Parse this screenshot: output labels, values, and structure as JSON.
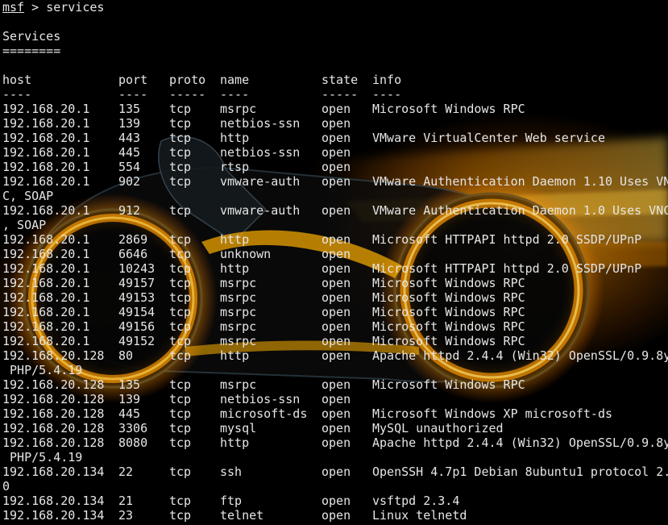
{
  "terminal": {
    "prompt": {
      "name": "msf",
      "separator": " > ",
      "command": "services"
    },
    "title": "Services",
    "title_underline": "========",
    "columns": [
      "host",
      "port",
      "proto",
      "name",
      "state",
      "info"
    ],
    "column_dashes": [
      "----",
      "----",
      "-----",
      "----",
      "-----",
      "----"
    ],
    "rows": [
      {
        "host": "192.168.20.1",
        "port": "135",
        "proto": "tcp",
        "name": "msrpc",
        "state": "open",
        "info": "Microsoft Windows RPC"
      },
      {
        "host": "192.168.20.1",
        "port": "139",
        "proto": "tcp",
        "name": "netbios-ssn",
        "state": "open",
        "info": ""
      },
      {
        "host": "192.168.20.1",
        "port": "443",
        "proto": "tcp",
        "name": "http",
        "state": "open",
        "info": "VMware VirtualCenter Web service"
      },
      {
        "host": "192.168.20.1",
        "port": "445",
        "proto": "tcp",
        "name": "netbios-ssn",
        "state": "open",
        "info": ""
      },
      {
        "host": "192.168.20.1",
        "port": "554",
        "proto": "tcp",
        "name": "rtsp",
        "state": "open",
        "info": ""
      },
      {
        "host": "192.168.20.1",
        "port": "902",
        "proto": "tcp",
        "name": "vmware-auth",
        "state": "open",
        "info": "VMware Authentication Daemon 1.10 Uses VN",
        "wrap": "C, SOAP"
      },
      {
        "host": "192.168.20.1",
        "port": "912",
        "proto": "tcp",
        "name": "vmware-auth",
        "state": "open",
        "info": "VMware Authentication Daemon 1.0 Uses VNC",
        "wrap": ", SOAP"
      },
      {
        "host": "192.168.20.1",
        "port": "2869",
        "proto": "tcp",
        "name": "http",
        "state": "open",
        "info": "Microsoft HTTPAPI httpd 2.0 SSDP/UPnP"
      },
      {
        "host": "192.168.20.1",
        "port": "6646",
        "proto": "tcp",
        "name": "unknown",
        "state": "open",
        "info": ""
      },
      {
        "host": "192.168.20.1",
        "port": "10243",
        "proto": "tcp",
        "name": "http",
        "state": "open",
        "info": "Microsoft HTTPAPI httpd 2.0 SSDP/UPnP"
      },
      {
        "host": "192.168.20.1",
        "port": "49157",
        "proto": "tcp",
        "name": "msrpc",
        "state": "open",
        "info": "Microsoft Windows RPC"
      },
      {
        "host": "192.168.20.1",
        "port": "49153",
        "proto": "tcp",
        "name": "msrpc",
        "state": "open",
        "info": "Microsoft Windows RPC"
      },
      {
        "host": "192.168.20.1",
        "port": "49154",
        "proto": "tcp",
        "name": "msrpc",
        "state": "open",
        "info": "Microsoft Windows RPC"
      },
      {
        "host": "192.168.20.1",
        "port": "49156",
        "proto": "tcp",
        "name": "msrpc",
        "state": "open",
        "info": "Microsoft Windows RPC"
      },
      {
        "host": "192.168.20.1",
        "port": "49152",
        "proto": "tcp",
        "name": "msrpc",
        "state": "open",
        "info": "Microsoft Windows RPC"
      },
      {
        "host": "192.168.20.128",
        "port": "80",
        "proto": "tcp",
        "name": "http",
        "state": "open",
        "info": "Apache httpd 2.4.4 (Win32) OpenSSL/0.9.8y",
        "wrap": " PHP/5.4.19"
      },
      {
        "host": "192.168.20.128",
        "port": "135",
        "proto": "tcp",
        "name": "msrpc",
        "state": "open",
        "info": "Microsoft Windows RPC"
      },
      {
        "host": "192.168.20.128",
        "port": "139",
        "proto": "tcp",
        "name": "netbios-ssn",
        "state": "open",
        "info": ""
      },
      {
        "host": "192.168.20.128",
        "port": "445",
        "proto": "tcp",
        "name": "microsoft-ds",
        "state": "open",
        "info": "Microsoft Windows XP microsoft-ds"
      },
      {
        "host": "192.168.20.128",
        "port": "3306",
        "proto": "tcp",
        "name": "mysql",
        "state": "open",
        "info": "MySQL unauthorized"
      },
      {
        "host": "192.168.20.128",
        "port": "8080",
        "proto": "tcp",
        "name": "http",
        "state": "open",
        "info": "Apache httpd 2.4.4 (Win32) OpenSSL/0.9.8y",
        "wrap": " PHP/5.4.19"
      },
      {
        "host": "192.168.20.134",
        "port": "22",
        "proto": "tcp",
        "name": "ssh",
        "state": "open",
        "info": "OpenSSH 4.7p1 Debian 8ubuntu1 protocol 2.",
        "wrap": "0"
      },
      {
        "host": "192.168.20.134",
        "port": "21",
        "proto": "tcp",
        "name": "ftp",
        "state": "open",
        "info": "vsftpd 2.3.4"
      },
      {
        "host": "192.168.20.134",
        "port": "23",
        "proto": "tcp",
        "name": "telnet",
        "state": "open",
        "info": "Linux telnetd"
      }
    ]
  },
  "colors": {
    "background": "#000000",
    "text": "#e6e6e6",
    "glow_orange": "#ff9a00",
    "glow_yellow": "#ffd34a"
  }
}
